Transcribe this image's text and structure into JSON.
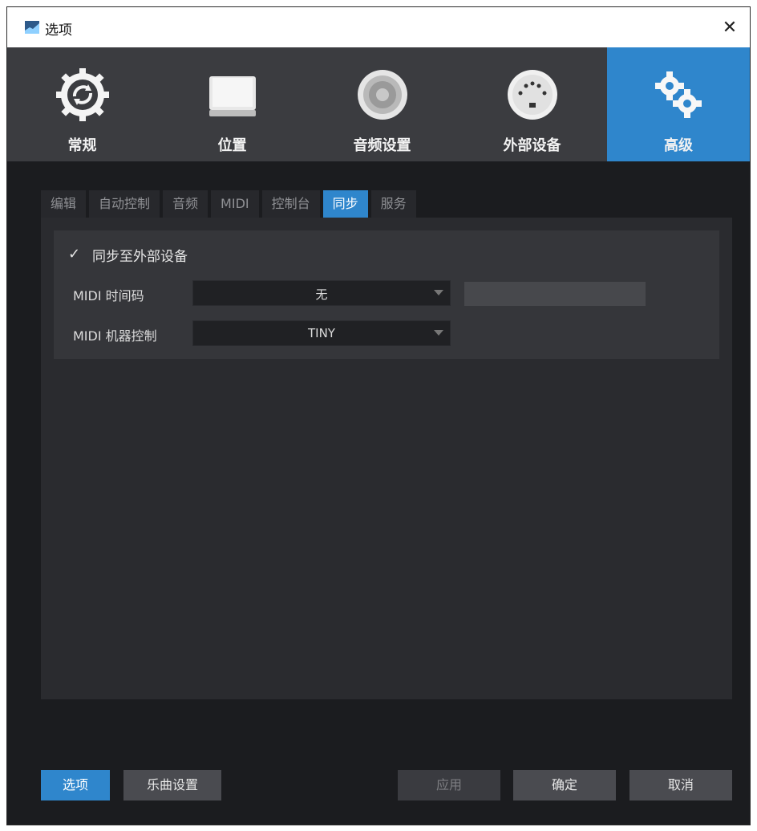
{
  "window": {
    "title": "选项"
  },
  "topnav": {
    "items": [
      {
        "label": "常规",
        "icon": "gear-refresh-icon"
      },
      {
        "label": "位置",
        "icon": "drive-icon"
      },
      {
        "label": "音频设置",
        "icon": "speaker-icon"
      },
      {
        "label": "外部设备",
        "icon": "midi-port-icon"
      },
      {
        "label": "高级",
        "icon": "gears-icon"
      }
    ],
    "active_index": 4,
    "active_color": "#2f86cc"
  },
  "subtabs": {
    "items": [
      "编辑",
      "自动控制",
      "音频",
      "MIDI",
      "控制台",
      "同步",
      "服务"
    ],
    "active_index": 5
  },
  "sync": {
    "sync_external_checked": true,
    "sync_external_label": "同步至外部设备",
    "midi_timecode_label": "MIDI 时间码",
    "midi_timecode_value": "无",
    "midi_machine_control_label": "MIDI 机器控制",
    "midi_machine_control_value": "TINY"
  },
  "footer": {
    "options_button": "选项",
    "song_settings_button": "乐曲设置",
    "apply_button": "应用",
    "ok_button": "确定",
    "cancel_button": "取消"
  }
}
